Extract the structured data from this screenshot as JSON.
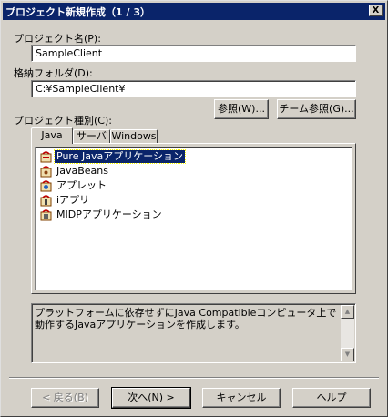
{
  "window": {
    "title": "プロジェクト新規作成（1 / 3）",
    "close_label": "X"
  },
  "project_name": {
    "label": "プロジェクト名(P):",
    "value": "SampleClient"
  },
  "folder": {
    "label": "格納フォルダ(D):",
    "value": "C:¥SampleClient¥"
  },
  "buttons": {
    "browse": "参照(W)...",
    "team_browse": "チーム参照(G)...",
    "back": "< 戻る(B)",
    "next": "次へ(N) >",
    "cancel": "キャンセル",
    "help": "ヘルプ"
  },
  "project_type": {
    "label": "プロジェクト種別(C):",
    "tabs": [
      {
        "label": "Java",
        "active": true
      },
      {
        "label": "サーバ",
        "active": false
      },
      {
        "label": "Windows",
        "active": false
      }
    ],
    "items": [
      {
        "label": "Pure Javaアプリケーション",
        "icon": "application-icon",
        "selected": true
      },
      {
        "label": "JavaBeans",
        "icon": "javabeans-icon",
        "selected": false
      },
      {
        "label": "アプレット",
        "icon": "applet-icon",
        "selected": false
      },
      {
        "label": "iアプリ",
        "icon": "iappli-icon",
        "selected": false
      },
      {
        "label": "MIDPアプリケーション",
        "icon": "midp-application-icon",
        "selected": false
      }
    ]
  },
  "description": "プラットフォームに依存せずにJava Compatibleコンピュータ上で動作するJavaアプリケーションを作成します。",
  "colors": {
    "title_bar": "#0a246a",
    "face": "#d4d0c8",
    "selection": "#0a246a"
  }
}
